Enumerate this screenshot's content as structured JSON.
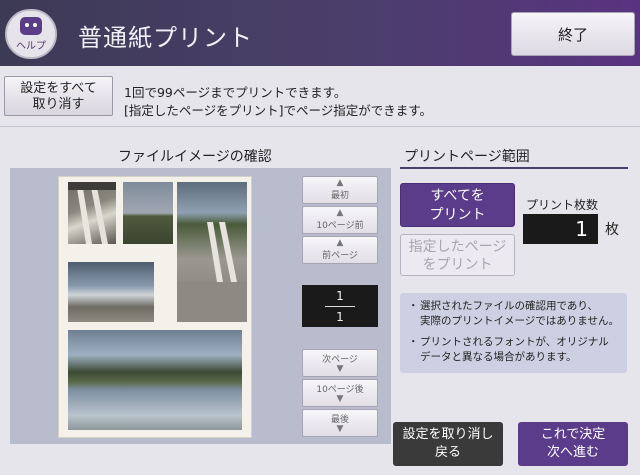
{
  "header": {
    "help_label": "ヘルプ",
    "title": "普通紙プリント",
    "end_label": "終了"
  },
  "toolbar": {
    "reset_label_1": "設定をすべて",
    "reset_label_2": "取り消す",
    "info_1": "1回で99ページまでプリントできます。",
    "info_2": "[指定したページをプリント]でページ指定ができます。"
  },
  "preview": {
    "title": "ファイルイメージの確認",
    "nav": {
      "first": "最初",
      "back10": "10ページ前",
      "prev": "前ページ",
      "next": "次ページ",
      "fwd10": "10ページ後",
      "last": "最後"
    },
    "page_current": "1",
    "page_total": "1"
  },
  "range": {
    "title": "プリントページ範囲",
    "all_label_1": "すべてを",
    "all_label_2": "プリント",
    "spec_label_1": "指定したページ",
    "spec_label_2": "をプリント",
    "copies_label": "プリント枚数",
    "copies_value": "1",
    "copies_unit": "枚",
    "notes": [
      [
        "選択されたファイルの確認用であり、",
        "実際のプリントイメージではありません。"
      ],
      [
        "プリントされるフォントが、オリジナル",
        "データと異なる場合があります。"
      ]
    ],
    "bullet": "・"
  },
  "footer": {
    "back_label_1": "設定を取り消し",
    "back_label_2": "戻る",
    "next_label_1": "これで決定",
    "next_label_2": "次へ進む"
  },
  "colors": {
    "accent": "#5b3c8a",
    "header_bg": "#4a3f6b",
    "dark_display": "#1a1a1a"
  }
}
